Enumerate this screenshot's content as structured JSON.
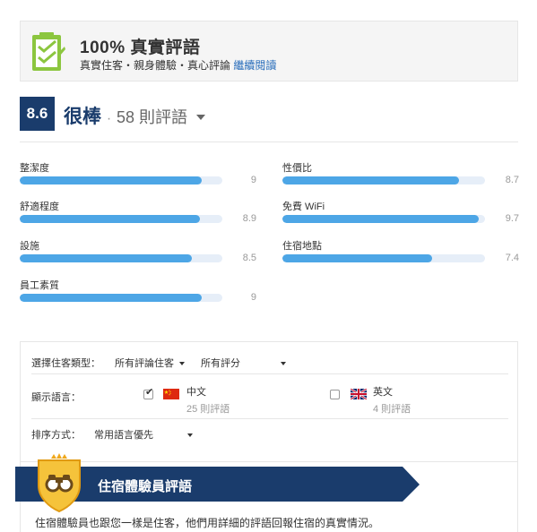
{
  "verified": {
    "title": "100% 真實評語",
    "subtitle": "真實住客・親身體驗・真心評論",
    "link": "繼續閱讀"
  },
  "summary": {
    "score": "8.6",
    "label": "很棒",
    "dot": "·",
    "count": "58 則評語"
  },
  "categories": [
    {
      "name": "整潔度",
      "value": "9",
      "fill": 0.9
    },
    {
      "name": "性價比",
      "value": "8.7",
      "fill": 0.87
    },
    {
      "name": "舒適程度",
      "value": "8.9",
      "fill": 0.89
    },
    {
      "name": "免費 WiFi",
      "value": "9.7",
      "fill": 0.97
    },
    {
      "name": "設施",
      "value": "8.5",
      "fill": 0.85
    },
    {
      "name": "住宿地點",
      "value": "7.4",
      "fill": 0.74
    },
    {
      "name": "員工素質",
      "value": "9",
      "fill": 0.9
    }
  ],
  "filters": {
    "guest_type_label": "選擇住客類型：",
    "guest_type_value": "所有評論住客",
    "rating_value": "所有評分",
    "language_label": "顯示語言：",
    "languages": [
      {
        "name": "中文",
        "count": "25 則評語",
        "checked": true
      },
      {
        "name": "英文",
        "count": "4 則評語",
        "checked": false
      }
    ],
    "sort_label": "排序方式：",
    "sort_value": "常用語言優先"
  },
  "expert": {
    "title": "住宿體驗員評語",
    "description": "住宿體驗員也跟您一樣是住客，他們用詳細的評語回報住宿的真實情況。"
  },
  "colors": {
    "brand": "#1a3c6c",
    "bar": "#4da6e6",
    "track": "#e6eef8",
    "link": "#2a6ebb",
    "badge_green": "#8cc63f"
  },
  "icons": {
    "verified": "checklist-icon",
    "expert": "binoculars-shield-icon"
  }
}
